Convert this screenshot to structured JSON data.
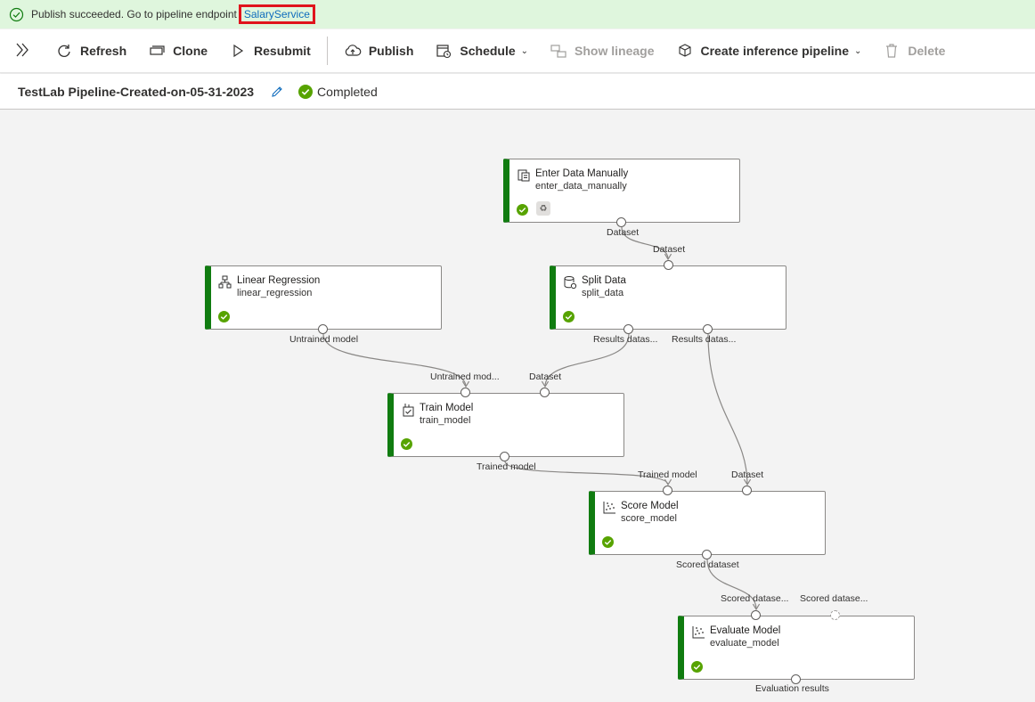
{
  "banner": {
    "message": "Publish succeeded. Go to pipeline endpoint",
    "link": "SalaryService",
    "icon": "check-circle-icon",
    "bg_color": "#dff6dd",
    "highlight_color": "#e0141c"
  },
  "toolbar": {
    "expand_icon": "double-chevron-right-icon",
    "refresh": "Refresh",
    "clone": "Clone",
    "resubmit": "Resubmit",
    "publish": "Publish",
    "schedule": "Schedule",
    "show_lineage": "Show lineage",
    "create_inference": "Create inference pipeline",
    "delete": "Delete"
  },
  "header": {
    "title": "TestLab Pipeline-Created-on-05-31-2023",
    "status": "Completed",
    "status_color": "#57a300"
  },
  "nodes": {
    "enter_data": {
      "title": "Enter Data Manually",
      "subtitle": "enter_data_manually",
      "out_label": "Dataset"
    },
    "linear_regression": {
      "title": "Linear Regression",
      "subtitle": "linear_regression",
      "out_label": "Untrained model"
    },
    "split_data": {
      "title": "Split Data",
      "subtitle": "split_data",
      "in_label": "Dataset",
      "out1_label": "Results datas...",
      "out2_label": "Results datas..."
    },
    "train_model": {
      "title": "Train Model",
      "subtitle": "train_model",
      "in1_label": "Untrained mod...",
      "in2_label": "Dataset",
      "out_label": "Trained model"
    },
    "score_model": {
      "title": "Score Model",
      "subtitle": "score_model",
      "in1_label": "Trained model",
      "in2_label": "Dataset",
      "out_label": "Scored dataset"
    },
    "evaluate_model": {
      "title": "Evaluate Model",
      "subtitle": "evaluate_model",
      "in1_label": "Scored datase...",
      "in2_label": "Scored datase...",
      "out_label": "Evaluation results"
    }
  },
  "colors": {
    "node_accent": "#107c10",
    "edge": "#8a8886",
    "link": "#0f6cbd"
  }
}
